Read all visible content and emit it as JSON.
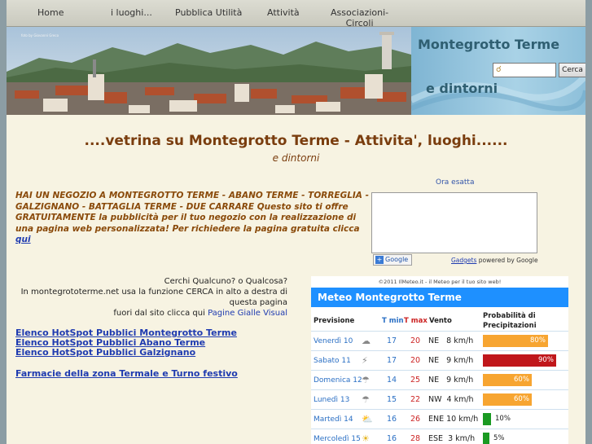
{
  "nav": {
    "items": [
      "Home",
      "i luoghi...",
      "Pubblica Utilità",
      "Attività",
      "Associazioni-\nCircoli"
    ]
  },
  "banner": {
    "photo_credit": "foto by Giovanni Greco",
    "title": "Montegrotto Terme",
    "subtitle": "e dintorni",
    "search_placeholder": "",
    "search_button": "Cerca"
  },
  "main": {
    "headline": "....vetrina su Montegrotto Terme - Attivita', luoghi......",
    "headline_sub": "e dintorni",
    "promo_text": "HAI UN NEGOZIO A MONTEGROTTO TERME - ABANO TERME - TORREGLIA - GALZIGNANO - BATTAGLIA TERME - DUE CARRARE Questo sito ti offre GRATUITAMENTE la pubblicità per il tuo negozio con la realizzazione di una pagina web personalizzata! Per richiedere la pagina gratuita clicca",
    "promo_link": "qui",
    "clock_title": "Ora esatta",
    "google_badge": "Google",
    "gadgets_link": "Gadgets",
    "gadgets_suffix": "powered by Google",
    "search_help_line1": "Cerchi Qualcuno? o Qualcosa?",
    "search_help_line2": "In montegrototerme.net usa la funzione CERCA in alto a destra di questa pagina",
    "search_help_line3": "fuori dal sito clicca qui",
    "search_help_link": "Pagine Gialle Visual",
    "links": [
      "Elenco HotSpot Pubblici Montegrotto Terme",
      "Elenco HotSpot Pubblici Abano Terme",
      "Elenco HotSpot Pubblici Galzignano",
      "Farmacie della zona Termale e Turno festivo"
    ]
  },
  "weather": {
    "credit": "©2011 IlMeteo.it - il Meteo per il tuo sito web!",
    "title": "Meteo Montegrotto Terme",
    "col_forecast": "Previsione",
    "col_tmin": "T min",
    "col_tmax": "T max",
    "col_wind": "Vento",
    "col_precip": "Probabilità di Precipitazioni",
    "rows": [
      {
        "day": "Venerdì 10",
        "icon": "cloud-icon",
        "tmin": "17",
        "tmax": "20",
        "wind": "NE   8 km/h",
        "precip": 80,
        "precip_label": "80%",
        "color": "#f7a531"
      },
      {
        "day": "Sabato 11",
        "icon": "storm-icon",
        "tmin": "17",
        "tmax": "20",
        "wind": "NE   9 km/h",
        "precip": 90,
        "precip_label": "90%",
        "color": "#c0171b"
      },
      {
        "day": "Domenica 12",
        "icon": "rain-sun-icon",
        "tmin": "14",
        "tmax": "25",
        "wind": "NE   9 km/h",
        "precip": 60,
        "precip_label": "60%",
        "color": "#f7a531"
      },
      {
        "day": "Lunedì 13",
        "icon": "rain-icon",
        "tmin": "15",
        "tmax": "22",
        "wind": "NW  4 km/h",
        "precip": 60,
        "precip_label": "60%",
        "color": "#f7a531"
      },
      {
        "day": "Martedì 14",
        "icon": "sun-cloud-icon",
        "tmin": "16",
        "tmax": "26",
        "wind": "ENE 10 km/h",
        "precip": 10,
        "precip_label": "10%",
        "color": "#1a9a22"
      },
      {
        "day": "Mercoledì 15",
        "icon": "sun-icon",
        "tmin": "16",
        "tmax": "28",
        "wind": "ESE  3 km/h",
        "precip": 5,
        "precip_label": "5%",
        "color": "#1a9a22"
      }
    ]
  }
}
